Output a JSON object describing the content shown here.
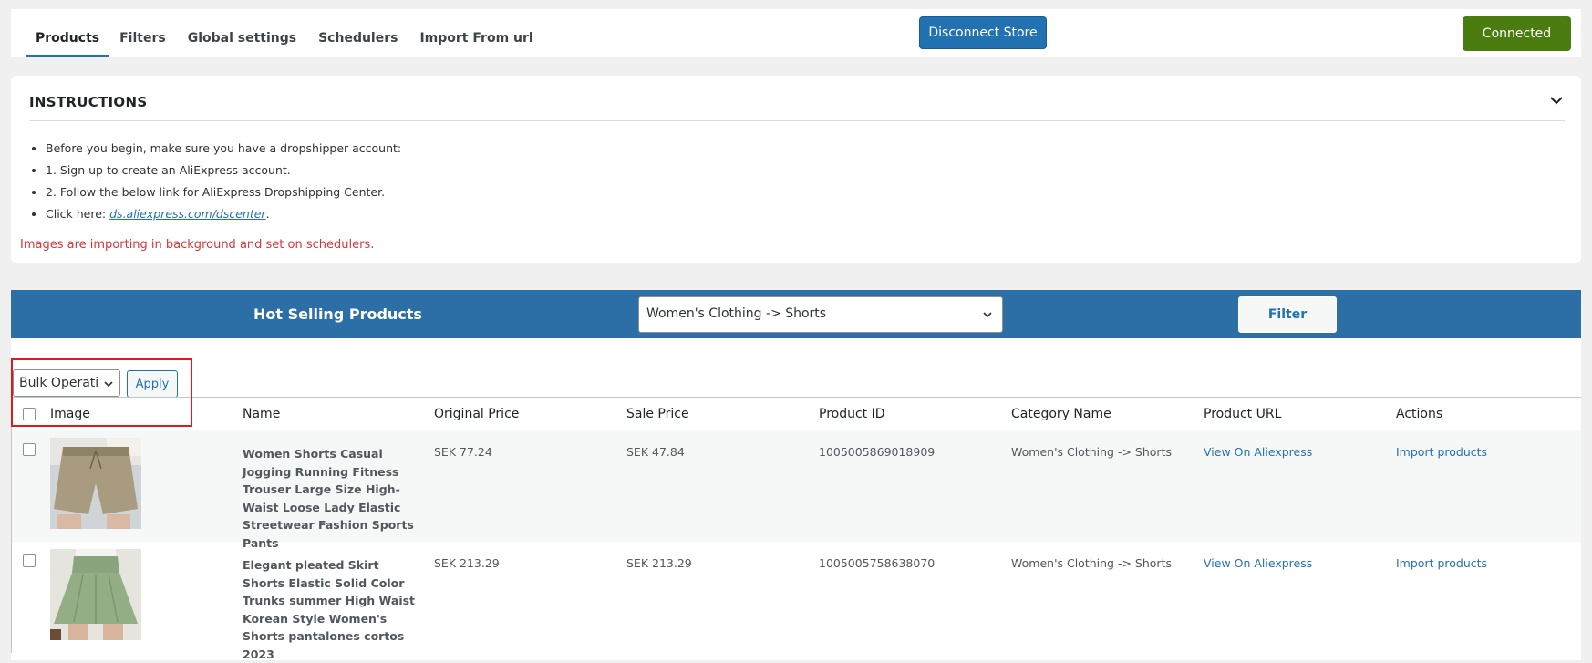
{
  "tabs": [
    {
      "label": "Products",
      "active": true
    },
    {
      "label": "Filters"
    },
    {
      "label": "Global settings"
    },
    {
      "label": "Schedulers"
    },
    {
      "label": "Import From url"
    }
  ],
  "header": {
    "disconnect_label": "Disconnect Store",
    "connected_label": "Connected",
    "connected_color": "#4a7c10"
  },
  "instructions": {
    "title": "INSTRUCTIONS",
    "items": [
      "Before you begin, make sure you have a dropshipper account:",
      "1. Sign up to create an AliExpress account.",
      "2. Follow the below link for AliExpress Dropshipping Center.",
      "Click here: "
    ],
    "link_text": "ds.aliexpress.com/dscenter",
    "link_suffix": ".",
    "notice": "Images are importing in background and set on schedulers.",
    "notice_color": "#d63638"
  },
  "hot_selling": {
    "title": "Hot Selling Products",
    "category_selected": "Women's Clothing -> Shorts",
    "filter_label": "Filter"
  },
  "bulk": {
    "selected": "Bulk Operations",
    "apply_label": "Apply"
  },
  "table": {
    "columns": [
      "Image",
      "Name",
      "Original Price",
      "Sale Price",
      "Product ID",
      "Category Name",
      "Product URL",
      "Actions"
    ],
    "rows": [
      {
        "name": "Women Shorts Casual Jogging Running Fitness Trouser Large Size High-Waist Loose Lady Elastic Streetwear Fashion Sports Pants",
        "original_price": "SEK 77.24",
        "sale_price": "SEK 47.84",
        "product_id": "1005005869018909",
        "category": "Women's Clothing -> Shorts",
        "url_label": "View On Aliexpress",
        "action_label": "Import products",
        "image_icon": "khaki-shorts-photo"
      },
      {
        "name": "Elegant pleated Skirt Shorts Elastic Solid Color Trunks summer High Waist Korean Style Women's Shorts  pantalones cortos 2023",
        "original_price": "SEK 213.29",
        "sale_price": "SEK 213.29",
        "product_id": "1005005758638070",
        "category": "Women's Clothing -> Shorts",
        "url_label": "View On Aliexpress",
        "action_label": "Import products",
        "image_icon": "green-skirt-shorts-photo"
      }
    ]
  }
}
